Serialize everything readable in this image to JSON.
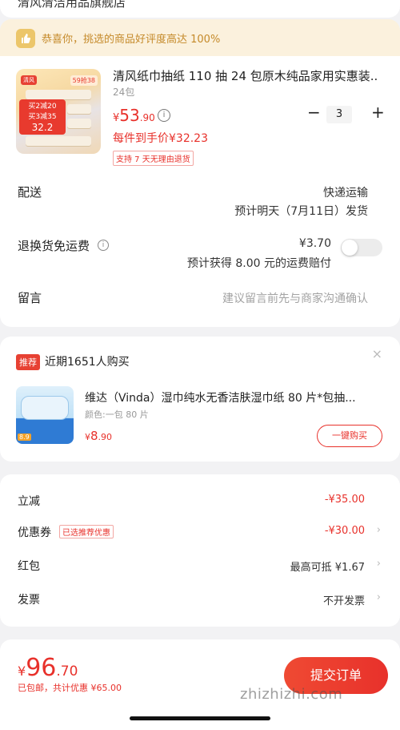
{
  "top": {
    "store_name": "清风清洁用品旗舰店"
  },
  "banner": {
    "text": "恭喜你，挑选的商品好评度高达 100%",
    "icon": "thumbs-up-icon"
  },
  "product": {
    "title": "清风纸巾抽纸 110 抽 24 包原木纯品家用实惠装...",
    "spec": "24包",
    "price_currency": "¥",
    "price_int": "53",
    "price_dec": ".90",
    "net_price": "每件到手价¥32.23",
    "return_badge": "支持 7 天无理由退货",
    "quantity": "3",
    "minus": "−",
    "plus": "+",
    "thumb": {
      "tag": "清风",
      "price_tag": "59抢38",
      "promo_line1": "买2减20",
      "promo_line2": "买3减35",
      "promo_line3": "32.2"
    }
  },
  "delivery": {
    "label": "配送",
    "method": "快递运输",
    "eta": "预计明天（7月11日）发货"
  },
  "return_shipping": {
    "label": "退换货免运费",
    "price": "¥3.70",
    "note": "预计获得 8.00 元的运费赔付",
    "enabled": false
  },
  "message": {
    "label": "留言",
    "placeholder": "建议留言前先与商家沟通确认"
  },
  "recommend": {
    "badge": "推荐",
    "heading": "近期1651人购买",
    "close": "×",
    "title": "维达（Vinda）湿巾纯水无香洁肤湿巾纸 80 片*包抽...",
    "spec": "颜色:一包 80 片",
    "price_currency": "¥",
    "price_int": "8",
    "price_dec": ".90",
    "buy_label": "一键购买",
    "thumb_price": "8.9"
  },
  "summary": {
    "rows": [
      {
        "label": "立减",
        "value": "-¥35.00",
        "chevron": ""
      },
      {
        "label": "优惠券",
        "tag": "已选推荐优惠",
        "value": "-¥30.00",
        "chevron": "›"
      },
      {
        "label": "红包",
        "value": "最高可抵 ¥1.67",
        "chevron": "›"
      },
      {
        "label": "发票",
        "value": "不开发票",
        "chevron": "›"
      }
    ]
  },
  "bottom": {
    "total_currency": "¥",
    "total_int": "96",
    "total_dec": ".70",
    "savings": "已包邮，共计优惠 ¥65.00",
    "submit_label": "提交订单",
    "watermark": "zhizhizhi.com"
  }
}
